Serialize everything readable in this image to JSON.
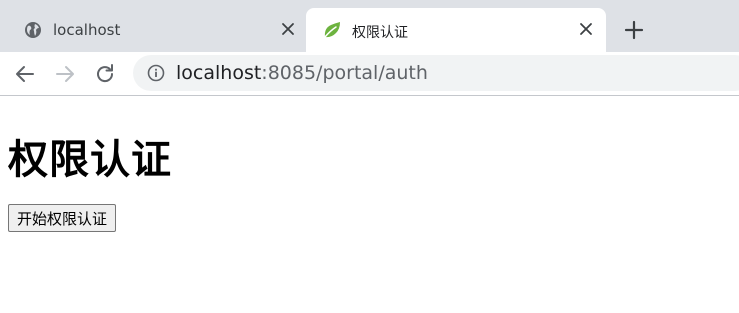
{
  "browser": {
    "tabs": [
      {
        "title": "localhost",
        "favicon": "globe-icon",
        "active": false
      },
      {
        "title": "权限认证",
        "favicon": "spring-leaf-icon",
        "active": true
      }
    ],
    "address_bar": {
      "host": "localhost",
      "rest": ":8085/portal/auth"
    },
    "colors": {
      "tabstrip": "#dee1e6",
      "active_tab": "#ffffff",
      "omnibox": "#f1f3f4",
      "leaf": "#6db33f"
    }
  },
  "page": {
    "heading": "权限认证",
    "button_label": "开始权限认证"
  }
}
